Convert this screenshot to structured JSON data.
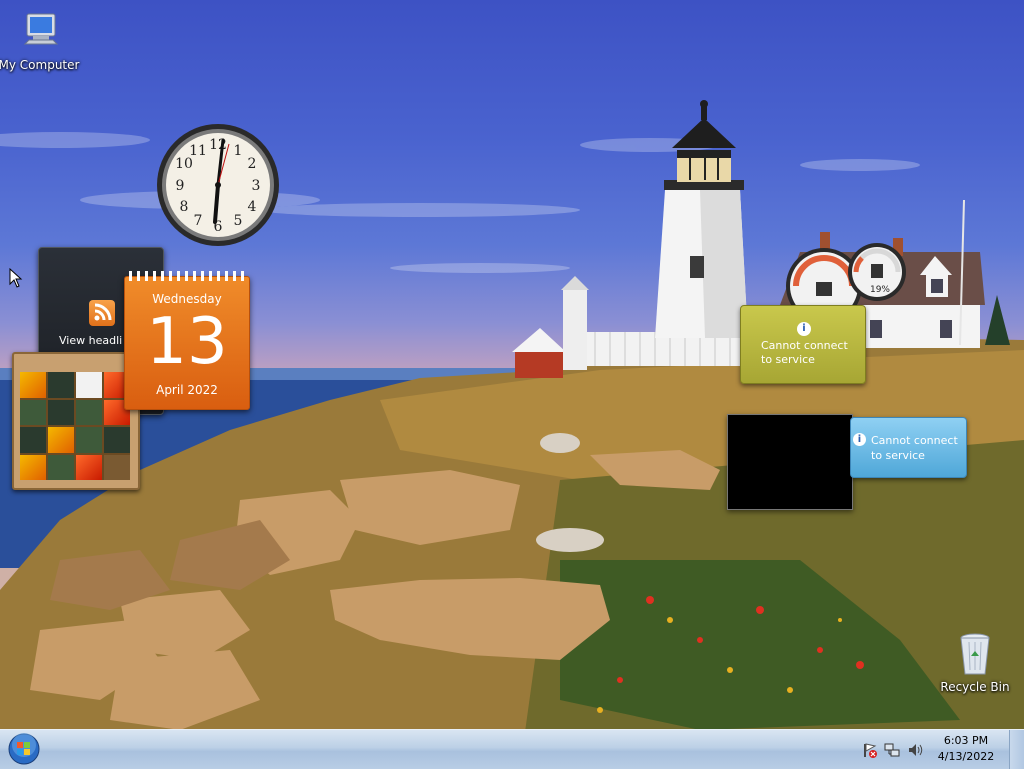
{
  "desktop": {
    "icons": [
      {
        "id": "my-computer",
        "label": "My Computer",
        "icon": "computer-icon"
      },
      {
        "id": "recycle-bin",
        "label": "Recycle Bin",
        "icon": "recycle-bin-icon"
      }
    ]
  },
  "gadgets": {
    "clock": {
      "icon": "analog-clock"
    },
    "feed": {
      "label": "View headli",
      "icon": "rss-icon"
    },
    "calendar": {
      "weekday": "Wednesday",
      "day": "13",
      "month_year": "April 2022"
    },
    "weather": {
      "info_glyph": "i",
      "message": "Cannot connect to service"
    },
    "currency": {
      "info_glyph": "i",
      "message": "Cannot connect to service"
    },
    "meter": {
      "percent_label": "19%"
    }
  },
  "taskbar": {
    "start_icon": "windows-orb-icon",
    "tray": {
      "icons": [
        "action-center-flag-icon",
        "network-icon",
        "volume-icon"
      ],
      "time": "6:03 PM",
      "date": "4/13/2022"
    }
  },
  "colors": {
    "calendar_orange": "#e8741c",
    "weather_yellow": "#b8b73e",
    "currency_blue": "#6bbbe6",
    "taskbar_blue": "#bcd0e6"
  }
}
